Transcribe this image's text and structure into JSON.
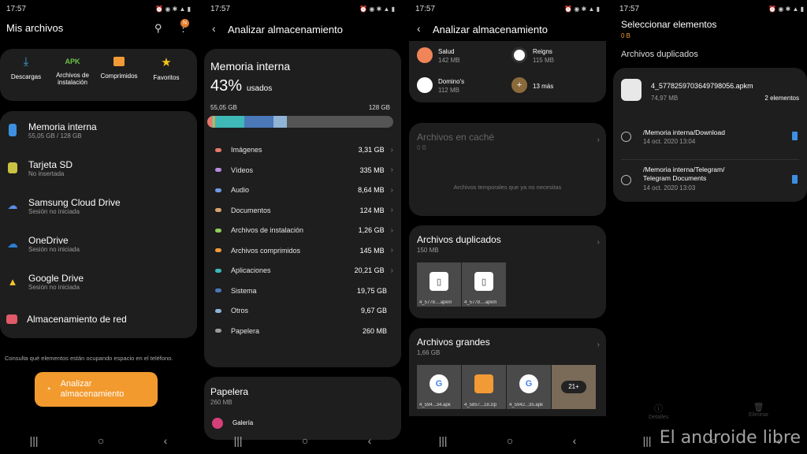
{
  "status": {
    "time": "17:57",
    "icons": "⏰ ◉ ✱ ▲ ▮"
  },
  "s1": {
    "title": "Mis archivos",
    "badge": "N",
    "categories": [
      {
        "label": "Descargas",
        "icon": "download-icon"
      },
      {
        "label": "Archivos de instalación",
        "icon": "apk-icon",
        "glyph": "APK"
      },
      {
        "label": "Comprimidos",
        "icon": "zip-icon"
      },
      {
        "label": "Favoritos",
        "icon": "star-icon"
      }
    ],
    "locations": [
      {
        "title": "Memoria interna",
        "sub": "55,05 GB / 128 GB"
      },
      {
        "title": "Tarjeta SD",
        "sub": "No insertada"
      },
      {
        "title": "Samsung Cloud Drive",
        "sub": "Sesión no iniciada"
      },
      {
        "title": "OneDrive",
        "sub": "Sesión no iniciada"
      },
      {
        "title": "Google Drive",
        "sub": "Sesión no iniciada"
      },
      {
        "title": "Almacenamiento de red",
        "sub": ""
      }
    ],
    "hint": "Consulta qué elementos están ocupando espacio en el teléfono.",
    "analyze_button": "Analizar almacenamiento"
  },
  "s2": {
    "title": "Analizar almacenamiento",
    "memory_title": "Memoria interna",
    "percent": "43%",
    "used_label": "usados",
    "used": "55,05 GB",
    "total": "128 GB",
    "used_fraction": 0.43,
    "legend": [
      {
        "name": "Imágenes",
        "value": "3,31 GB",
        "color": "#e8796a"
      },
      {
        "name": "Vídeos",
        "value": "335 MB",
        "color": "#b98be0"
      },
      {
        "name": "Audio",
        "value": "8,64 MB",
        "color": "#6f9ae8"
      },
      {
        "name": "Documentos",
        "value": "124 MB",
        "color": "#d6a36f"
      },
      {
        "name": "Archivos de instalación",
        "value": "1,26 GB",
        "color": "#8ccf5a"
      },
      {
        "name": "Archivos comprimidos",
        "value": "145 MB",
        "color": "#f29a36"
      },
      {
        "name": "Aplicaciones",
        "value": "20,21 GB",
        "color": "#3fb8b8"
      },
      {
        "name": "Sistema",
        "value": "19,75 GB",
        "color": "#4a78b8"
      },
      {
        "name": "Otros",
        "value": "9,67 GB",
        "color": "#8fb4d6"
      },
      {
        "name": "Papelera",
        "value": "260 MB",
        "color": "#9a9a9a"
      }
    ],
    "trash_title": "Papelera",
    "trash_size": "260 MB",
    "gallery": "Galería"
  },
  "s3": {
    "title": "Analizar almacenamiento",
    "apps": [
      {
        "name": "Salud",
        "size": "142 MB"
      },
      {
        "name": "Reigns",
        "size": "115 MB"
      },
      {
        "name": "Domino's",
        "size": "112 MB"
      },
      {
        "name": "",
        "size": "13 más"
      }
    ],
    "cache_title": "Archivos en caché",
    "cache_size": "0 B",
    "cache_hint": "Archivos temporales que ya no necesitas",
    "dup_title": "Archivos duplicados",
    "dup_size": "150 MB",
    "dup_thumbs": [
      "4_5778....apkm",
      "4_5778....apkm"
    ],
    "large_title": "Archivos grandes",
    "large_size": "1,66 GB",
    "large_thumbs": [
      "4_594...34.apk",
      "4_5857...18.zip",
      "4_5942...35.apk"
    ],
    "more_count": "21+"
  },
  "s4": {
    "title": "Seleccionar elementos",
    "selected_size": "0 B",
    "section": "Archivos duplicados",
    "file_name": "4_5778259703649798056.apkm",
    "file_size": "74,97 MB",
    "file_count": "2 elementos",
    "entries": [
      {
        "path": "/Memoria interna/Download",
        "date": "14 oct. 2020 13:04"
      },
      {
        "path": "/Memoria interna/Telegram/ Telegram Documents",
        "date": "14 oct. 2020 13:03"
      }
    ],
    "details": "Detalles",
    "delete": "Eliminar"
  },
  "watermark": "El androide libre",
  "nav": {
    "recent": "|||",
    "home": "○",
    "back": "‹"
  }
}
